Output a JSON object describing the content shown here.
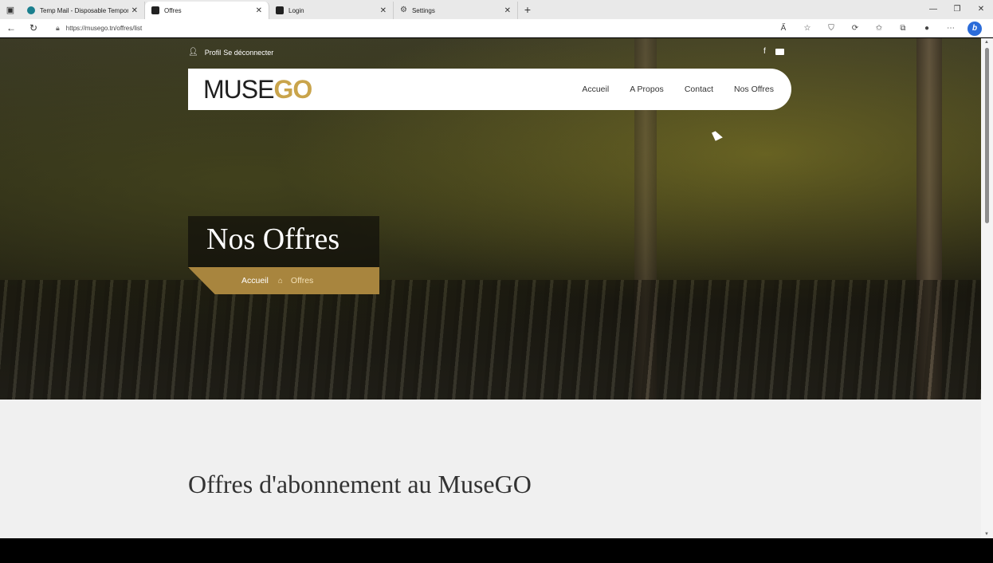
{
  "browser": {
    "tabs": [
      {
        "label": "Temp Mail - Disposable Tempora",
        "active": false
      },
      {
        "label": "Offres",
        "active": true
      },
      {
        "label": "Login",
        "active": false
      },
      {
        "label": "Settings",
        "active": false
      }
    ],
    "url": "https://musego.tn/offres/list"
  },
  "site": {
    "topbar": {
      "profile": "Profil",
      "logout": "Se déconnecter"
    },
    "logo": {
      "part1": "MUSE",
      "part2": "GO"
    },
    "menu": [
      "Accueil",
      "A Propos",
      "Contact",
      "Nos Offres"
    ],
    "hero": {
      "title": "Nos Offres",
      "breadcrumb": {
        "home": "Accueil",
        "current": "Offres"
      }
    },
    "section_title": "Offres d'abonnement au MuseGO"
  },
  "colors": {
    "accent": "#c9a44b",
    "breadcrumb_bg": "#a8853e"
  }
}
